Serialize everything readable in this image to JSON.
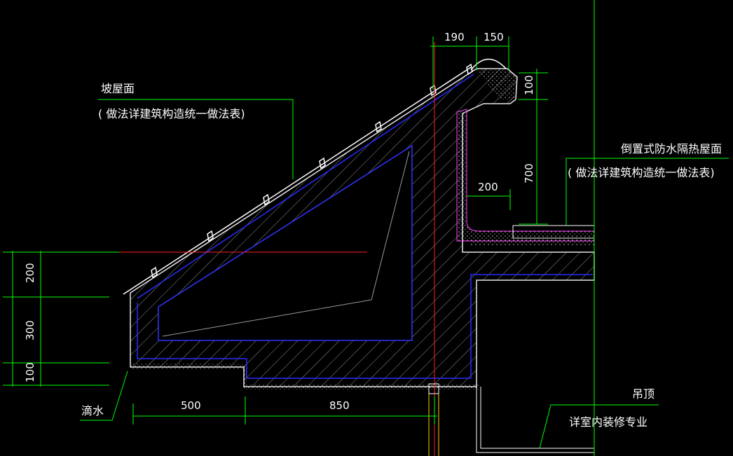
{
  "colors": {
    "background": "#000000",
    "white": "#ffffff",
    "green": "#00ff00",
    "blue": "#0000ff",
    "red": "#ff0000",
    "magenta": "#ff00ff",
    "yellow": "#ffff00",
    "grey": "#9a9a9a"
  },
  "labels": {
    "slope_roof_title": "坡屋面",
    "slope_roof_note": "( 做法详建筑构造统一做法表)",
    "inverted_roof_title": "倒置式防水隔热屋面",
    "inverted_roof_note": "( 做法详建筑构造统一做法表)",
    "drip": "滴水",
    "ceiling_title": "吊顶",
    "ceiling_note": "详室内装修专业"
  },
  "dimensions": {
    "top_left": "190",
    "top_right": "150",
    "right_upper": "100",
    "right_lower": "700",
    "inner_radius": "200",
    "left_upper": "200",
    "left_middle": "300",
    "left_lower": "100",
    "bottom_left": "500",
    "bottom_right": "850"
  }
}
